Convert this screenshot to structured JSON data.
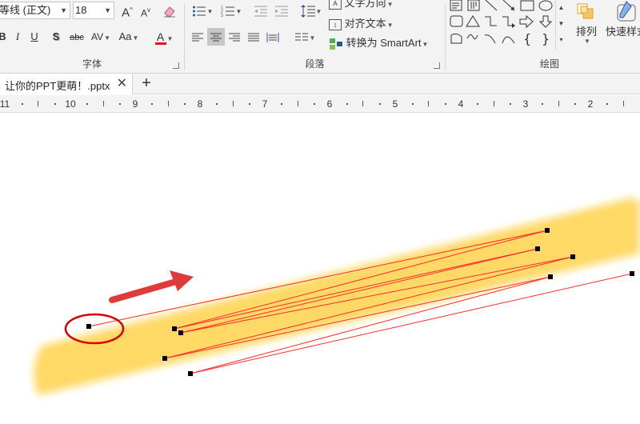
{
  "ribbon": {
    "font": {
      "family_value": "等线 (正文)",
      "size_value": "18",
      "grow_label": "A",
      "shrink_label": "A",
      "bold_label": "B",
      "italic_label": "I",
      "underline_label": "U",
      "shadow_label": "S",
      "strike_label": "abc",
      "spacing_label": "AV",
      "case_label": "Aa",
      "color_label": "A",
      "color_value": "#e81123",
      "group_label": "字体"
    },
    "paragraph": {
      "text_direction_label": "文字方向",
      "align_text_label": "对齐文本",
      "smartart_label": "转换为 SmartArt",
      "group_label": "段落"
    },
    "drawing": {
      "arrange_label": "排列",
      "quick_styles_label": "快速样式",
      "group_label": "绘图"
    }
  },
  "tabbar": {
    "doc_title": "让你的PPT更萌！.pptx",
    "close_symbol": "✕",
    "new_symbol": "+"
  },
  "ruler": {
    "labels": [
      "11",
      "10",
      "9",
      "8",
      "7",
      "6",
      "5",
      "4",
      "3",
      "2"
    ]
  },
  "canvas": {
    "highlight_color": "#ffd966",
    "line_color": "#ff2a2a",
    "arrow_color": "#e03b3b",
    "callout_color": "#d90000"
  }
}
